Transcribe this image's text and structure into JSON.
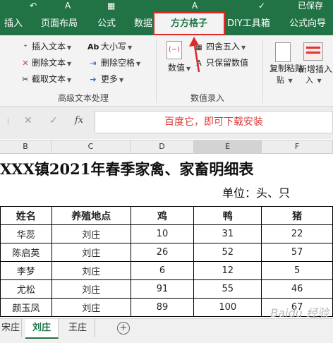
{
  "titlebar": {
    "saved": "已保存"
  },
  "tabs": [
    {
      "label": "插入"
    },
    {
      "label": "页面布局"
    },
    {
      "label": "公式"
    },
    {
      "label": "数据"
    },
    {
      "label": "方方格子"
    },
    {
      "label": "DIY工具箱"
    },
    {
      "label": "公式向导"
    }
  ],
  "ribbon": {
    "text_group": {
      "items": [
        "插入文本",
        "删除文本",
        "截取文本",
        "大小写",
        "删除空格",
        "更多"
      ],
      "label": "高级文本处理"
    },
    "number_group": {
      "value_label": "数值",
      "round_label": "四舍五入",
      "keep_label": "只保留数值",
      "label": "数值录入"
    },
    "paste_label": "复制粘贴",
    "insert_label": "新增插入"
  },
  "formula_bar": {
    "fx": "fx",
    "text": "百度它，即可下载安装"
  },
  "columns": [
    "B",
    "C",
    "D",
    "E",
    "F"
  ],
  "sheet": {
    "title": "XXX镇2021年春季家禽、家畜明细表",
    "unit": "单位：头、只",
    "headers": [
      "姓名",
      "养殖地点",
      "鸡",
      "鸭",
      "猪"
    ],
    "rows": [
      [
        "华蕊",
        "刘庄",
        "10",
        "31",
        "22"
      ],
      [
        "陈启英",
        "刘庄",
        "26",
        "52",
        "57"
      ],
      [
        "李梦",
        "刘庄",
        "6",
        "12",
        "5"
      ],
      [
        "尤松",
        "刘庄",
        "91",
        "55",
        "46"
      ],
      [
        "颜玉凤",
        "刘庄",
        "89",
        "100",
        "67"
      ]
    ]
  },
  "sheet_tabs": [
    "宋庄",
    "刘庄",
    "王庄"
  ],
  "watermark": "Baidu 经验"
}
